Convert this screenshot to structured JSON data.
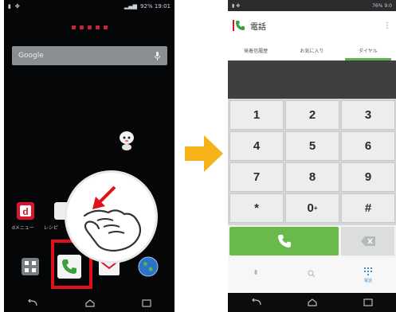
{
  "left_phone": {
    "status": {
      "right": "92% 19:01"
    },
    "search": {
      "label": "Google"
    },
    "app_labels": [
      "dメニュー",
      "レシピ"
    ],
    "dock": [
      "apps",
      "phone",
      "mail",
      "browser"
    ]
  },
  "right_phone": {
    "status": {
      "right": "76% 9:0"
    },
    "app_title": "電話",
    "menu_icon": "⋮",
    "tabs": [
      "発着信履歴",
      "お気に入り",
      "ダイヤル"
    ],
    "active_tab": 2,
    "keys": [
      {
        "main": "1",
        "sub": ""
      },
      {
        "main": "2",
        "sub": ""
      },
      {
        "main": "3",
        "sub": ""
      },
      {
        "main": "4",
        "sub": ""
      },
      {
        "main": "5",
        "sub": ""
      },
      {
        "main": "6",
        "sub": ""
      },
      {
        "main": "7",
        "sub": ""
      },
      {
        "main": "8",
        "sub": ""
      },
      {
        "main": "9",
        "sub": ""
      },
      {
        "main": "*",
        "sub": ""
      },
      {
        "main": "0",
        "sub": "+"
      },
      {
        "main": "#",
        "sub": ""
      }
    ],
    "bottom_bar": [
      "",
      "",
      "電話"
    ]
  },
  "colors": {
    "highlight": "#e0111a",
    "arrow": "#f6b317",
    "call_green": "#6aba4b",
    "tab_underline": "#5fb34a"
  }
}
